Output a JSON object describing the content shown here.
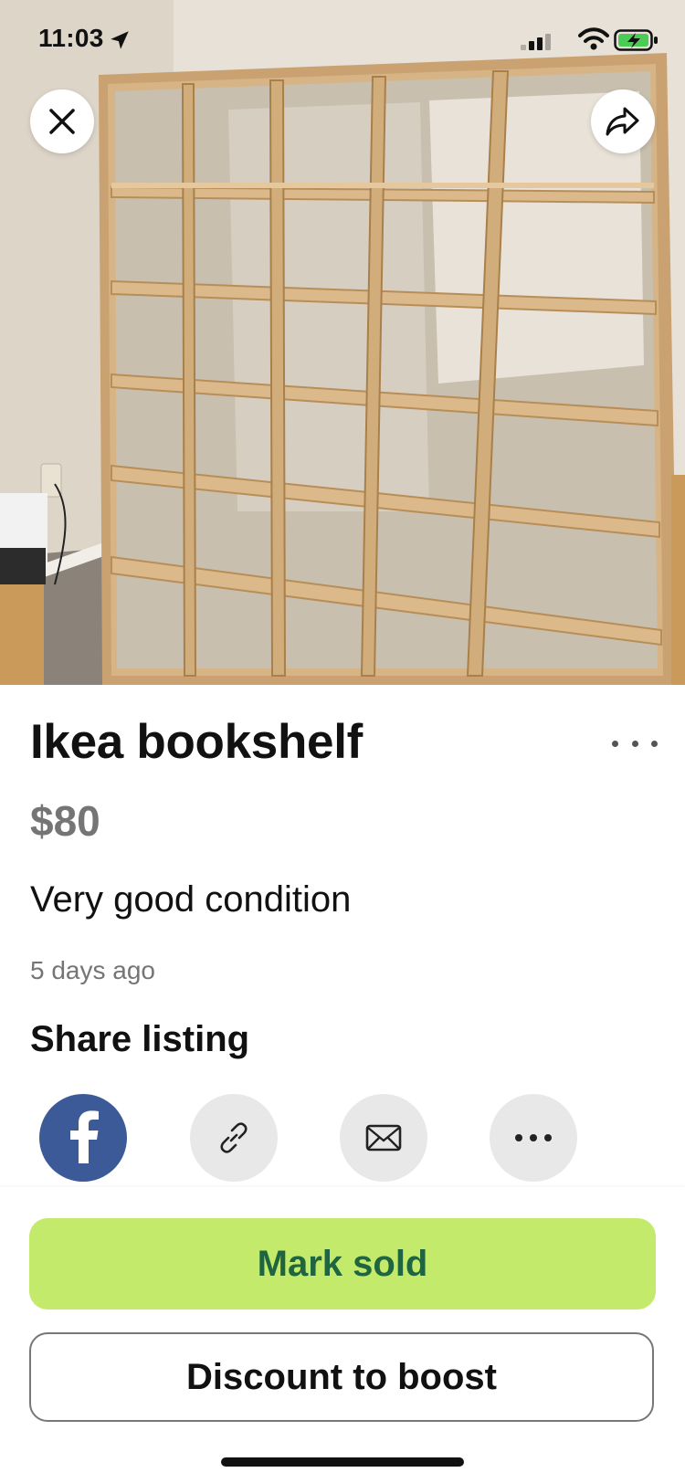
{
  "status_bar": {
    "time": "11:03",
    "icons": [
      "location-arrow-icon",
      "cellular-signal-icon",
      "wifi-icon",
      "battery-charging-icon"
    ]
  },
  "photo": {
    "subject": "bookshelf-photo",
    "accent_colors": {
      "wood": "#d2ad7c",
      "wall": "#e6e0d6",
      "carpet": "#8a8077"
    }
  },
  "top_actions": {
    "close_icon": "close-icon",
    "share_icon": "share-arrow-icon"
  },
  "listing": {
    "title": "Ikea bookshelf",
    "price": "$80",
    "description": "Very good condition",
    "posted": "5 days ago",
    "more_icon": "ellipsis-icon"
  },
  "share": {
    "heading": "Share listing",
    "targets": [
      {
        "icon": "facebook-icon",
        "color": "#3d5a98"
      },
      {
        "icon": "link-icon",
        "color": "#e8e8e8"
      },
      {
        "icon": "mail-icon",
        "color": "#e8e8e8"
      },
      {
        "icon": "more-horizontal-icon",
        "color": "#e8e8e8"
      }
    ]
  },
  "actions": {
    "mark_sold": "Mark sold",
    "discount": "Discount to boost",
    "primary_color": "#c4ea6b",
    "primary_text_color": "#1f6640"
  }
}
